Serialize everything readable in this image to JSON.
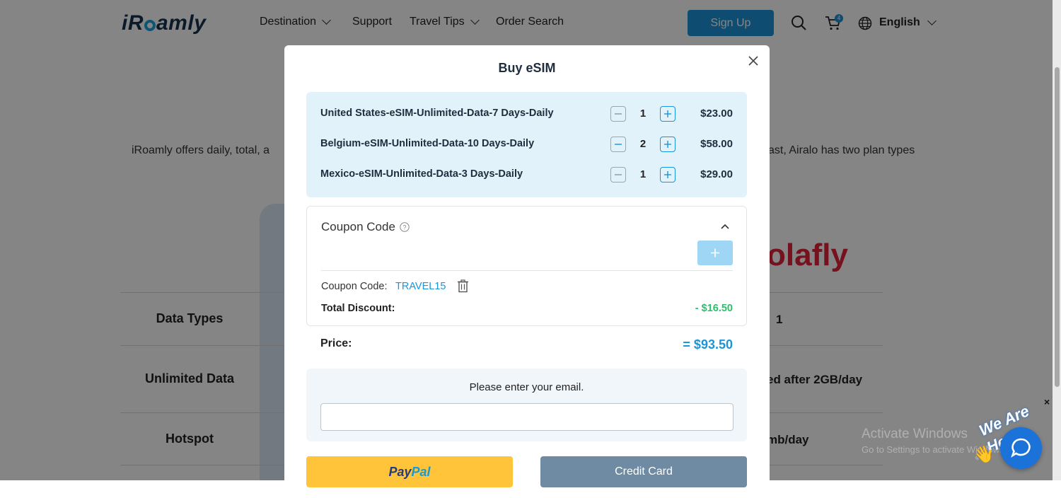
{
  "header": {
    "logo": "iRoamly",
    "nav": {
      "destination": "Destination",
      "support": "Support",
      "travel_tips": "Travel Tips",
      "order_search": "Order Search"
    },
    "signup_label": "Sign Up",
    "cart_count": "4",
    "language": "English",
    "accent": "#1b95d8"
  },
  "background": {
    "intro_left": "iRoamly offers daily, total, a",
    "intro_right": "ast, Airalo has two plan types",
    "brand_right": "olafly",
    "rows": [
      {
        "label": "Data Types",
        "right": "1"
      },
      {
        "label": "Unlimited Data",
        "right": "ed after 2GB/day"
      },
      {
        "label": "Hotspot",
        "right": "mb/day"
      }
    ]
  },
  "modal": {
    "title": "Buy eSIM",
    "items": [
      {
        "name": "United States-eSIM-Unlimited-Data-7 Days-Daily",
        "qty": "1",
        "price": "$23.00"
      },
      {
        "name": "Belgium-eSIM-Unlimited-Data-10 Days-Daily",
        "qty": "2",
        "price": "$58.00"
      },
      {
        "name": "Mexico-eSIM-Unlimited-Data-3 Days-Daily",
        "qty": "1",
        "price": "$29.00"
      }
    ],
    "coupon": {
      "heading": "Coupon Code",
      "applied_label": "Coupon Code:",
      "applied_code": "TRAVEL15",
      "discount_label": "Total Discount:",
      "discount_value": "- $16.50"
    },
    "price_label": "Price:",
    "price_total": "= $93.50",
    "email": {
      "label": "Please enter your email.",
      "value": ""
    },
    "paypal": {
      "part1": "Pay",
      "part2": "Pal"
    },
    "credit_card_label": "Credit Card"
  },
  "overlay_extras": {
    "watermark_title": "Activate Windows",
    "watermark_sub": "Go to Settings to activate Windows.",
    "chat_tag": "We Are Here!",
    "chat_close": "×"
  }
}
